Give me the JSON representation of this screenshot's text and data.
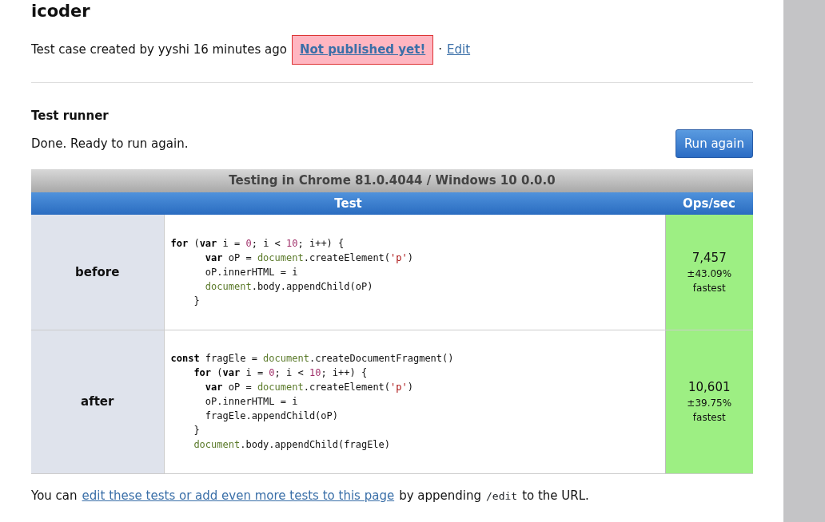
{
  "title": "icoder",
  "meta": {
    "text": "Test case created by yyshi 16 minutes ago",
    "status_link": "Not published yet!",
    "separator": "·",
    "edit_link": "Edit"
  },
  "runner": {
    "heading": "Test runner",
    "status": "Done. Ready to run again.",
    "button": "Run again"
  },
  "table": {
    "caption": "Testing in Chrome 81.0.4044 / Windows 10 0.0.0",
    "columns": [
      "Test",
      "Ops/sec"
    ],
    "rows": [
      {
        "name": "before",
        "ops": "7,457",
        "margin": "±43.09%",
        "rank": "fastest",
        "fastest": true,
        "code": [
          [
            {
              "kind": "kw",
              "text": "for"
            },
            {
              "kind": "plain",
              "text": " ("
            },
            {
              "kind": "kw",
              "text": "var"
            },
            {
              "kind": "plain",
              "text": " i = "
            },
            {
              "kind": "num",
              "text": "0"
            },
            {
              "kind": "plain",
              "text": "; i < "
            },
            {
              "kind": "num",
              "text": "10"
            },
            {
              "kind": "plain",
              "text": "; i++) {"
            }
          ],
          [
            {
              "kind": "kw",
              "text": "      var"
            },
            {
              "kind": "plain",
              "text": " oP = "
            },
            {
              "kind": "global",
              "text": "document"
            },
            {
              "kind": "plain",
              "text": ".createElement("
            },
            {
              "kind": "str",
              "text": "'p'"
            },
            {
              "kind": "plain",
              "text": ")"
            }
          ],
          [
            {
              "kind": "plain",
              "text": "      oP.innerHTML = i"
            }
          ],
          [
            {
              "kind": "global",
              "text": "      document"
            },
            {
              "kind": "plain",
              "text": ".body.appendChild(oP)"
            }
          ],
          [
            {
              "kind": "plain",
              "text": "    }"
            }
          ]
        ]
      },
      {
        "name": "after",
        "ops": "10,601",
        "margin": "±39.75%",
        "rank": "fastest",
        "fastest": true,
        "code": [
          [
            {
              "kind": "kw",
              "text": "const"
            },
            {
              "kind": "plain",
              "text": " fragEle = "
            },
            {
              "kind": "global",
              "text": "document"
            },
            {
              "kind": "plain",
              "text": ".createDocumentFragment()"
            }
          ],
          [
            {
              "kind": "kw",
              "text": "    for"
            },
            {
              "kind": "plain",
              "text": " ("
            },
            {
              "kind": "kw",
              "text": "var"
            },
            {
              "kind": "plain",
              "text": " i = "
            },
            {
              "kind": "num",
              "text": "0"
            },
            {
              "kind": "plain",
              "text": "; i < "
            },
            {
              "kind": "num",
              "text": "10"
            },
            {
              "kind": "plain",
              "text": "; i++) {"
            }
          ],
          [
            {
              "kind": "kw",
              "text": "      var"
            },
            {
              "kind": "plain",
              "text": " oP = "
            },
            {
              "kind": "global",
              "text": "document"
            },
            {
              "kind": "plain",
              "text": ".createElement("
            },
            {
              "kind": "str",
              "text": "'p'"
            },
            {
              "kind": "plain",
              "text": ")"
            }
          ],
          [
            {
              "kind": "plain",
              "text": "      oP.innerHTML = i"
            }
          ],
          [
            {
              "kind": "plain",
              "text": "      fragEle.appendChild(oP)"
            }
          ],
          [
            {
              "kind": "plain",
              "text": "    }"
            }
          ],
          [
            {
              "kind": "global",
              "text": "    document"
            },
            {
              "kind": "plain",
              "text": ".body.appendChild(fragEle)"
            }
          ]
        ]
      }
    ]
  },
  "footer": {
    "before": "You can",
    "link": "edit these tests or add even more tests to this page",
    "middle": "by appending",
    "code": "/edit",
    "after": "to the URL."
  }
}
